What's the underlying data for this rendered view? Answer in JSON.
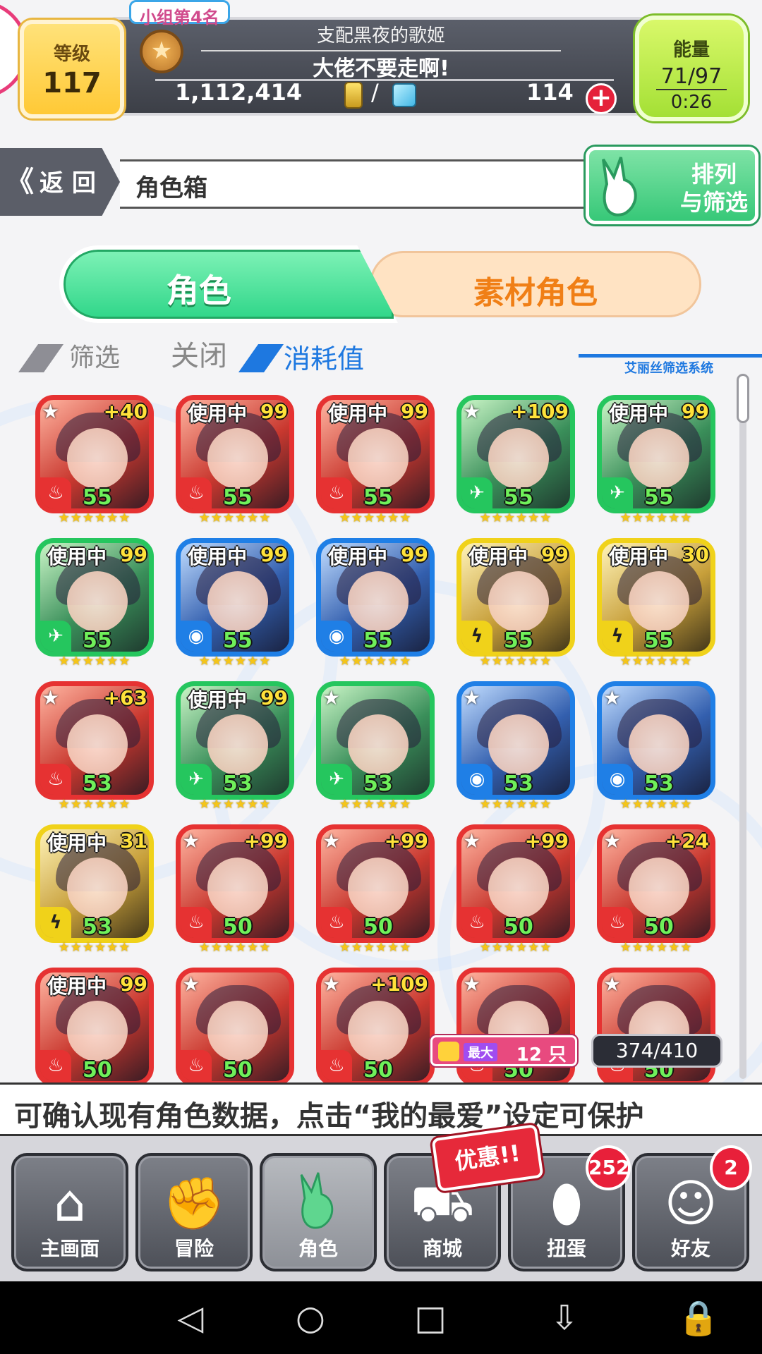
{
  "header": {
    "level_label": "等级",
    "level_value": "117",
    "group_rank": "小组第4名",
    "title": "支配黑夜的歌姬",
    "subtitle": "大佬不要走啊!",
    "coins": "1,112,414",
    "currency_separator": "/",
    "gems": "114",
    "energy_label": "能量",
    "energy_value": "71/97",
    "energy_timer": "0:26"
  },
  "nav": {
    "back_label": "返 回",
    "back_arrow": "《",
    "page_title": "角色箱",
    "sort_label_line1": "排列",
    "sort_label_line2": "与筛选"
  },
  "tabs": {
    "characters": "角色",
    "materials": "素材角色"
  },
  "filter": {
    "label": "筛选",
    "status": "关闭",
    "value": "消耗值",
    "system": "艾丽丝筛选系统"
  },
  "grid": {
    "in_use_label": "使用中",
    "star_row": "★★★★★★",
    "cards": [
      {
        "color": "red",
        "element": "fire",
        "level": "55",
        "tag": "+40",
        "in_use": false
      },
      {
        "color": "red",
        "element": "fire",
        "level": "55",
        "tag": "99",
        "in_use": true
      },
      {
        "color": "red",
        "element": "fire",
        "level": "55",
        "tag": "99",
        "in_use": true
      },
      {
        "color": "green",
        "element": "wind",
        "level": "55",
        "tag": "+109",
        "in_use": false
      },
      {
        "color": "green",
        "element": "wind",
        "level": "55",
        "tag": "99",
        "in_use": true
      },
      {
        "color": "green",
        "element": "wind",
        "level": "55",
        "tag": "99",
        "in_use": true
      },
      {
        "color": "blue",
        "element": "water",
        "level": "55",
        "tag": "99",
        "in_use": true
      },
      {
        "color": "blue",
        "element": "water",
        "level": "55",
        "tag": "99",
        "in_use": true
      },
      {
        "color": "yellow",
        "element": "thunder",
        "level": "55",
        "tag": "99",
        "in_use": true
      },
      {
        "color": "yellow",
        "element": "thunder",
        "level": "55",
        "tag": "30",
        "in_use": true
      },
      {
        "color": "red",
        "element": "fire",
        "level": "53",
        "tag": "+63",
        "in_use": false
      },
      {
        "color": "green",
        "element": "wind",
        "level": "53",
        "tag": "99",
        "in_use": true
      },
      {
        "color": "green",
        "element": "wind",
        "level": "53",
        "tag": "",
        "in_use": false
      },
      {
        "color": "blue",
        "element": "water",
        "level": "53",
        "tag": "",
        "in_use": false
      },
      {
        "color": "blue",
        "element": "water",
        "level": "53",
        "tag": "",
        "in_use": false
      },
      {
        "color": "yellow",
        "element": "thunder",
        "level": "53",
        "tag": "31",
        "in_use": true
      },
      {
        "color": "red",
        "element": "fire",
        "level": "50",
        "tag": "+99",
        "in_use": false
      },
      {
        "color": "red",
        "element": "fire",
        "level": "50",
        "tag": "+99",
        "in_use": false
      },
      {
        "color": "red",
        "element": "fire",
        "level": "50",
        "tag": "+99",
        "in_use": false
      },
      {
        "color": "red",
        "element": "fire",
        "level": "50",
        "tag": "+24",
        "in_use": false
      },
      {
        "color": "red",
        "element": "fire",
        "level": "50",
        "tag": "99",
        "in_use": true
      },
      {
        "color": "red",
        "element": "fire",
        "level": "50",
        "tag": "",
        "in_use": false
      },
      {
        "color": "red",
        "element": "fire",
        "level": "50",
        "tag": "+109",
        "in_use": false
      },
      {
        "color": "red",
        "element": "fire",
        "level": "50",
        "tag": "",
        "in_use": false
      },
      {
        "color": "red",
        "element": "fire",
        "level": "50",
        "tag": "",
        "in_use": false
      }
    ]
  },
  "badges": {
    "max_label": "最大",
    "max_value": "12 只",
    "box_count": "374/410",
    "promo": "优惠!!"
  },
  "ticker": {
    "text": "可确认现有角色数据，点击“我的最爱”设定可保护"
  },
  "bottom_nav": {
    "items": [
      {
        "label": "主画面",
        "icon": "home-icon"
      },
      {
        "label": "冒险",
        "icon": "handshake-icon"
      },
      {
        "label": "角色",
        "icon": "bunny-icon"
      },
      {
        "label": "商城",
        "icon": "cart-icon"
      },
      {
        "label": "扭蛋",
        "icon": "egg-icon"
      },
      {
        "label": "好友",
        "icon": "friends-icon"
      }
    ],
    "gacha_count": "252",
    "friends_count": "2"
  },
  "colors": {
    "red": "#e63232",
    "green": "#25c65e",
    "blue": "#1f7fe6",
    "yellow": "#f0d21a",
    "accent_green": "#37c878",
    "accent_orange": "#f07f16"
  }
}
